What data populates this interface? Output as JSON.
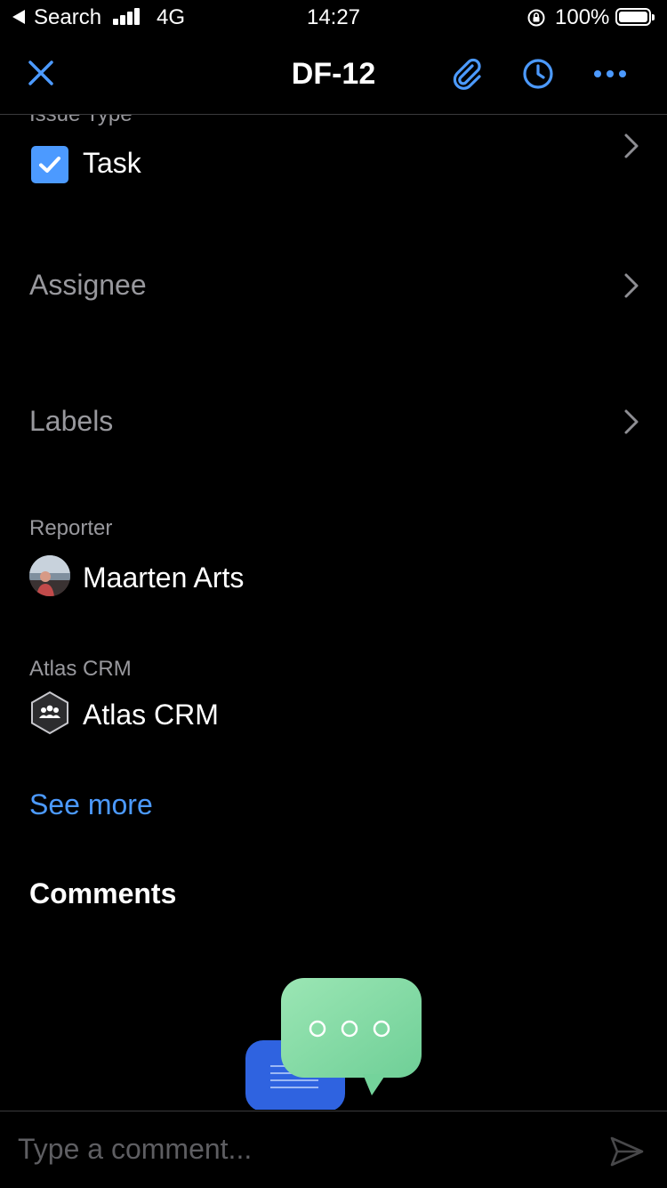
{
  "status_bar": {
    "back_label": "Search",
    "network": "4G",
    "time": "14:27",
    "battery": "100%"
  },
  "nav": {
    "title": "DF-12",
    "close_icon": "close-icon",
    "attach_icon": "paperclip-icon",
    "history_icon": "clock-icon",
    "more_icon": "more-icon",
    "accent_color": "#4c9aff"
  },
  "fields": {
    "issue_type": {
      "label": "Issue Type",
      "value": "Task",
      "icon": "task-checkbox-icon"
    },
    "assignee": {
      "label": "Assignee"
    },
    "labels": {
      "label": "Labels"
    },
    "reporter": {
      "label": "Reporter",
      "value": "Maarten Arts"
    },
    "project": {
      "label": "Atlas CRM",
      "value": "Atlas CRM",
      "icon": "project-hexagon-icon"
    }
  },
  "see_more": "See more",
  "comments": {
    "heading": "Comments",
    "placeholder": "Type a comment...",
    "send_icon": "send-icon"
  }
}
